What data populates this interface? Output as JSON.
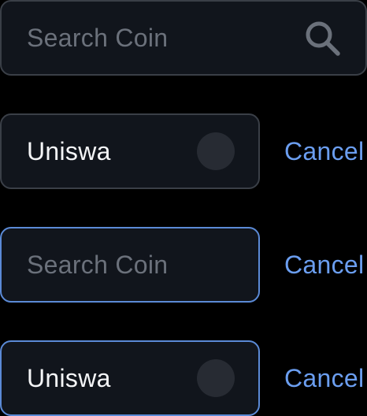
{
  "variants": [
    {
      "placeholder": "Search Coin"
    },
    {
      "value": "Uniswa",
      "cancel_label": "Cancel"
    },
    {
      "placeholder": "Search Coin",
      "cancel_label": "Cancel"
    },
    {
      "value": "Uniswa",
      "cancel_label": "Cancel"
    }
  ],
  "icons": {
    "search": "search-icon",
    "loading": "loading-spinner-icon"
  },
  "colors": {
    "background": "#000000",
    "field_bg": "#11151c",
    "border_default": "#3a3f47",
    "border_focused": "#5b8ad6",
    "placeholder_text": "#6b717b",
    "value_text": "#f4f5f7",
    "accent": "#6b9ef0"
  }
}
